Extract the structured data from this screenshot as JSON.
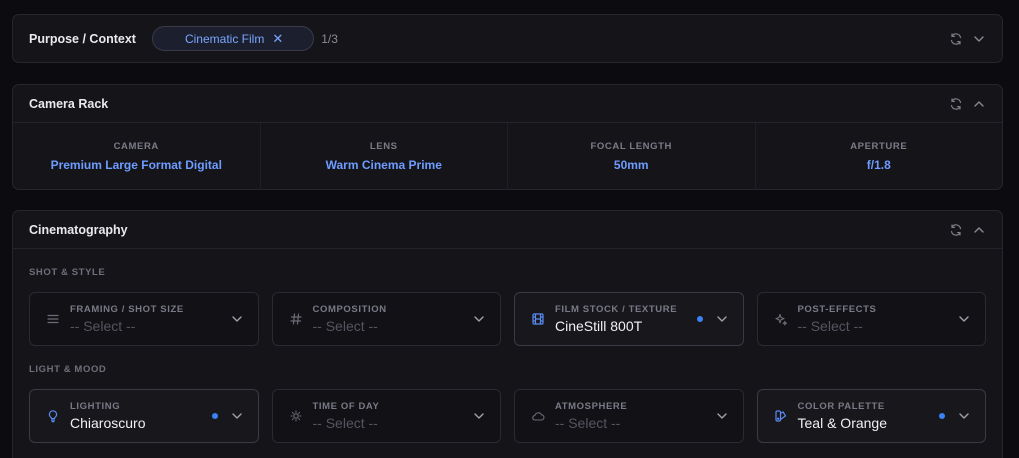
{
  "purpose": {
    "title": "Purpose / Context",
    "chip_label": "Cinematic Film",
    "chip_remove": "✕",
    "count": "1/3"
  },
  "camera_rack": {
    "title": "Camera Rack",
    "cells": [
      {
        "label": "CAMERA",
        "value": "Premium Large Format Digital"
      },
      {
        "label": "LENS",
        "value": "Warm Cinema Prime"
      },
      {
        "label": "FOCAL LENGTH",
        "value": "50mm"
      },
      {
        "label": "APERTURE",
        "value": "f/1.8"
      }
    ]
  },
  "cinematography": {
    "title": "Cinematography",
    "shot_style_label": "SHOT & STYLE",
    "light_mood_label": "LIGHT & MOOD",
    "shot_style": [
      {
        "label": "FRAMING / SHOT SIZE",
        "value": "-- Select --",
        "icon": "menu-lines-icon"
      },
      {
        "label": "COMPOSITION",
        "value": "-- Select --",
        "icon": "hash-icon"
      },
      {
        "label": "FILM STOCK / TEXTURE",
        "value": "CineStill 800T",
        "icon": "film-icon"
      },
      {
        "label": "POST-EFFECTS",
        "value": "-- Select --",
        "icon": "sparkle-icon"
      }
    ],
    "light_mood": [
      {
        "label": "LIGHTING",
        "value": "Chiaroscuro",
        "icon": "lightbulb-icon"
      },
      {
        "label": "TIME OF DAY",
        "value": "-- Select --",
        "icon": "sun-icon"
      },
      {
        "label": "ATMOSPHERE",
        "value": "-- Select --",
        "icon": "cloud-icon"
      },
      {
        "label": "COLOR PALETTE",
        "value": "Teal & Orange",
        "icon": "palette-icon"
      }
    ]
  },
  "colors": {
    "background": "#0c0c10",
    "panel": "#141419",
    "accent": "#6f9cff",
    "indicator_dot": "#3b82f6"
  }
}
